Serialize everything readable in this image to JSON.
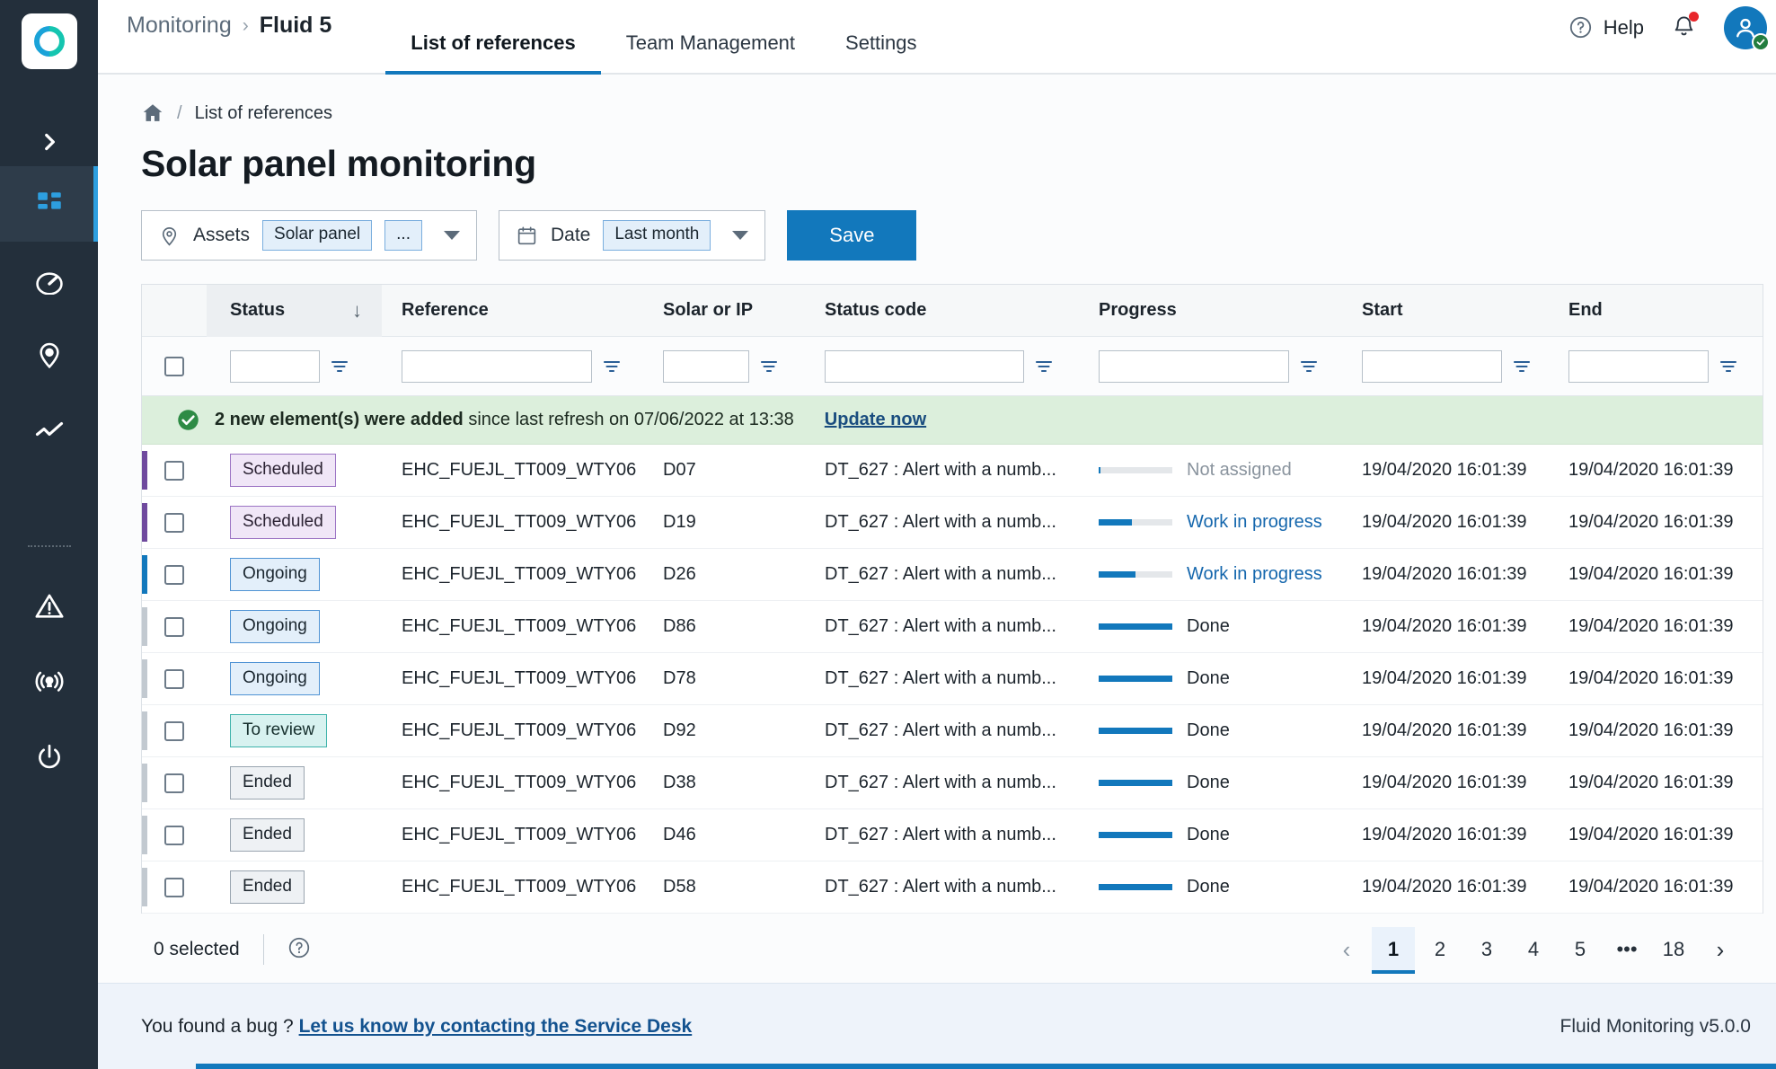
{
  "colors": {
    "accent": "#1278bc",
    "sidebar_bg": "#232f3b",
    "sidebar_active": "#2e3c4a",
    "banner_green": "#dcefdc",
    "footer_bg": "#eef3fa",
    "purple_bar": "#6f4a9e",
    "blue_bar": "#1278bc",
    "grey_bar": "#c2c9d0"
  },
  "sidebar": {
    "logo_name": "fluid-logo",
    "expand_label": "expand-sidebar",
    "items": [
      {
        "name": "sidebar-item-dashboard",
        "icon": "grid-icon",
        "active": true
      },
      {
        "name": "sidebar-item-gauge",
        "icon": "gauge-icon",
        "active": false
      },
      {
        "name": "sidebar-item-location",
        "icon": "map-pin-icon",
        "active": false
      },
      {
        "name": "sidebar-item-analytics",
        "icon": "trend-line-icon",
        "active": false
      }
    ],
    "bottom_items": [
      {
        "name": "sidebar-item-alerts",
        "icon": "warning-triangle-icon"
      },
      {
        "name": "sidebar-item-broadcast",
        "icon": "broadcast-icon"
      },
      {
        "name": "sidebar-item-power",
        "icon": "power-icon"
      }
    ]
  },
  "topbar": {
    "breadcrumb_app": "Monitoring",
    "breadcrumb_separator": "›",
    "breadcrumb_project": "Fluid 5",
    "tabs": [
      {
        "label": "List of references",
        "active": true
      },
      {
        "label": "Team Management",
        "active": false
      },
      {
        "label": "Settings",
        "active": false
      }
    ],
    "help_label": "Help",
    "notifications_icon": "bell-icon",
    "avatar_icon": "user-avatar-icon"
  },
  "page": {
    "home_icon": "home-icon",
    "breadcrumb_slash": "/",
    "breadcrumb_current": "List of references",
    "title": "Solar panel monitoring"
  },
  "filters": {
    "assets": {
      "icon": "map-pin-icon",
      "label": "Assets",
      "chips": [
        "Solar panel",
        "..."
      ]
    },
    "date": {
      "icon": "calendar-icon",
      "label": "Date",
      "chips": [
        "Last month"
      ]
    },
    "save_label": "Save"
  },
  "table": {
    "columns": [
      {
        "key": "status",
        "label": "Status",
        "sorted": true,
        "sort_icon": "arrow-down-icon"
      },
      {
        "key": "reference",
        "label": "Reference",
        "sorted": false
      },
      {
        "key": "solar_or_ip",
        "label": "Solar or IP",
        "sorted": false
      },
      {
        "key": "status_code",
        "label": "Status code",
        "sorted": false
      },
      {
        "key": "progress",
        "label": "Progress",
        "sorted": false
      },
      {
        "key": "start",
        "label": "Start",
        "sorted": false
      },
      {
        "key": "end",
        "label": "End",
        "sorted": false
      }
    ],
    "filter_inputs": {
      "status": "",
      "reference": "",
      "solar_or_ip": "",
      "status_code": "",
      "progress": "",
      "start": "",
      "end": ""
    },
    "notification": {
      "icon": "check-circle-icon",
      "bold_text": "2 new element(s) were added",
      "rest_text": " since last refresh on 07/06/2022 at 13:38",
      "link": "Update now"
    },
    "rows": [
      {
        "bar": "#6f4a9e",
        "status": "Scheduled",
        "status_style": "scheduled",
        "reference": "EHC_FUEJL_TT009_WTY06",
        "solar_or_ip": "D07",
        "status_code": "DT_627 : Alert with a numb...",
        "progress_pct": 3,
        "progress_label": "Not assigned",
        "progress_label_style": "muted",
        "start": "19/04/2020 16:01:39",
        "end": "19/04/2020 16:01:39"
      },
      {
        "bar": "#6f4a9e",
        "status": "Scheduled",
        "status_style": "scheduled",
        "reference": "EHC_FUEJL_TT009_WTY06",
        "solar_or_ip": "D19",
        "status_code": "DT_627 : Alert with a numb...",
        "progress_pct": 45,
        "progress_label": "Work in progress",
        "progress_label_style": "link",
        "start": "19/04/2020 16:01:39",
        "end": "19/04/2020 16:01:39"
      },
      {
        "bar": "#1278bc",
        "status": "Ongoing",
        "status_style": "ongoing",
        "reference": "EHC_FUEJL_TT009_WTY06",
        "solar_or_ip": "D26",
        "status_code": "DT_627 : Alert with a numb...",
        "progress_pct": 50,
        "progress_label": "Work in progress",
        "progress_label_style": "link",
        "start": "19/04/2020 16:01:39",
        "end": "19/04/2020 16:01:39"
      },
      {
        "bar": "#c2c9d0",
        "status": "Ongoing",
        "status_style": "ongoing",
        "reference": "EHC_FUEJL_TT009_WTY06",
        "solar_or_ip": "D86",
        "status_code": "DT_627 : Alert with a numb...",
        "progress_pct": 100,
        "progress_label": "Done",
        "progress_label_style": "normal",
        "start": "19/04/2020 16:01:39",
        "end": "19/04/2020 16:01:39"
      },
      {
        "bar": "#c2c9d0",
        "status": "Ongoing",
        "status_style": "ongoing",
        "reference": "EHC_FUEJL_TT009_WTY06",
        "solar_or_ip": "D78",
        "status_code": "DT_627 : Alert with a numb...",
        "progress_pct": 100,
        "progress_label": "Done",
        "progress_label_style": "normal",
        "start": "19/04/2020 16:01:39",
        "end": "19/04/2020 16:01:39"
      },
      {
        "bar": "#c2c9d0",
        "status": "To review",
        "status_style": "toreview",
        "reference": "EHC_FUEJL_TT009_WTY06",
        "solar_or_ip": "D92",
        "status_code": "DT_627 : Alert with a numb...",
        "progress_pct": 100,
        "progress_label": "Done",
        "progress_label_style": "normal",
        "start": "19/04/2020 16:01:39",
        "end": "19/04/2020 16:01:39"
      },
      {
        "bar": "#c2c9d0",
        "status": "Ended",
        "status_style": "ended",
        "reference": "EHC_FUEJL_TT009_WTY06",
        "solar_or_ip": "D38",
        "status_code": "DT_627 : Alert with a numb...",
        "progress_pct": 100,
        "progress_label": "Done",
        "progress_label_style": "normal",
        "start": "19/04/2020 16:01:39",
        "end": "19/04/2020 16:01:39"
      },
      {
        "bar": "#c2c9d0",
        "status": "Ended",
        "status_style": "ended",
        "reference": "EHC_FUEJL_TT009_WTY06",
        "solar_or_ip": "D46",
        "status_code": "DT_627 : Alert with a numb...",
        "progress_pct": 100,
        "progress_label": "Done",
        "progress_label_style": "normal",
        "start": "19/04/2020 16:01:39",
        "end": "19/04/2020 16:01:39"
      },
      {
        "bar": "#c2c9d0",
        "status": "Ended",
        "status_style": "ended",
        "reference": "EHC_FUEJL_TT009_WTY06",
        "solar_or_ip": "D58",
        "status_code": "DT_627 : Alert with a numb...",
        "progress_pct": 100,
        "progress_label": "Done",
        "progress_label_style": "normal",
        "start": "19/04/2020 16:01:39",
        "end": "19/04/2020 16:01:39"
      }
    ],
    "footer": {
      "selected_text": "0 selected",
      "help_icon": "question-circle-icon",
      "pagination": {
        "prev": "‹",
        "next": "›",
        "pages": [
          "1",
          "2",
          "3",
          "4",
          "5",
          "•••",
          "18"
        ],
        "current": "1"
      }
    }
  },
  "footer": {
    "bug_text": "You found a bug ?",
    "bug_link": "Let us know by contacting the Service Desk",
    "version": "Fluid Monitoring v5.0.0"
  }
}
